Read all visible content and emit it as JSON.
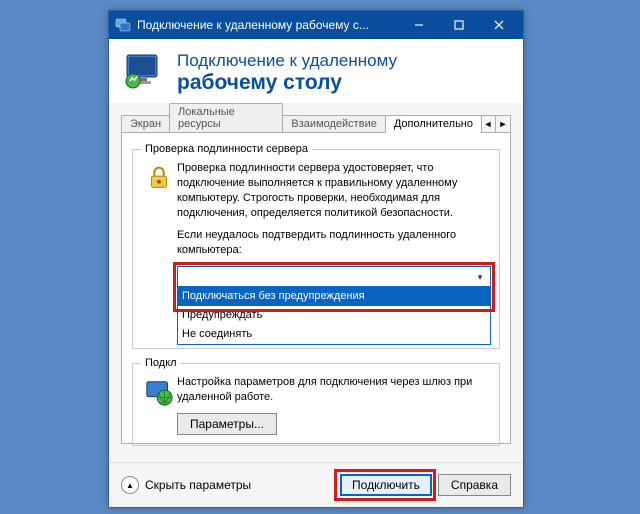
{
  "window": {
    "title": "Подключение к удаленному рабочему с..."
  },
  "banner": {
    "line1": "Подключение к удаленному",
    "line2": "рабочему столу"
  },
  "tabs": {
    "items": [
      {
        "label": "Экран"
      },
      {
        "label": "Локальные ресурсы"
      },
      {
        "label": "Взаимодействие"
      },
      {
        "label": "Дополнительно"
      }
    ],
    "nav_left": "◄",
    "nav_right": "►"
  },
  "group_auth": {
    "legend": "Проверка подлинности сервера",
    "desc": "Проверка подлинности сервера удостоверяет, что подключение выполняется к правильному удаленному компьютеру. Строгость проверки, необходимая для подключения, определяется политикой безопасности.",
    "prompt": "Если неудалось подтвердить подлинность удаленного компьютера:",
    "dropdown": {
      "current": "",
      "options": [
        {
          "label": "Подключаться без предупреждения"
        },
        {
          "label": "Предупреждать"
        },
        {
          "label": "Не соединять"
        }
      ]
    }
  },
  "group_conn": {
    "legend": "Подкл",
    "desc": "Настройка параметров для подключения через шлюз при удаленной работе.",
    "params_btn": "Параметры..."
  },
  "footer": {
    "expand_label": "Скрыть параметры",
    "connect": "Подключить",
    "help": "Справка"
  }
}
